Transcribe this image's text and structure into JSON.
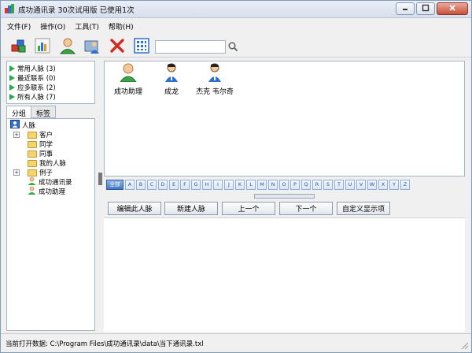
{
  "window": {
    "title": "成功通讯录 30次试用版 已使用1次",
    "minimize_icon": "minimize-icon",
    "maximize_icon": "maximize-icon",
    "close_icon": "close-icon"
  },
  "menu": {
    "items": [
      "文件(F)",
      "操作(O)",
      "工具(T)",
      "帮助(H)"
    ]
  },
  "toolbar": {
    "buttons": [
      "add-contacts-icon",
      "chart-icon",
      "person-icon",
      "import-icon",
      "delete-icon",
      "grid-view-icon"
    ],
    "search_value": "",
    "search_icon": "search-icon"
  },
  "recent": {
    "items": [
      "常用人脉 (3)",
      "最近联系 (0)",
      "应多联系 (2)",
      "所有人脉 (7)"
    ],
    "accent": "#2da64a"
  },
  "tabs": {
    "items": [
      "分组",
      "标签"
    ],
    "active": "分组"
  },
  "tree": {
    "root": "人脉",
    "children": [
      {
        "label": "客户",
        "expandable": true
      },
      {
        "label": "同学",
        "expandable": false
      },
      {
        "label": "同事",
        "expandable": false
      },
      {
        "label": "我的人脉",
        "expandable": false
      },
      {
        "label": "例子",
        "expandable": true
      },
      {
        "label": "成功通讯录",
        "expandable": false,
        "type": "person"
      },
      {
        "label": "成功助理",
        "expandable": false,
        "type": "person"
      }
    ]
  },
  "contacts": [
    {
      "name": "成功助理",
      "icon": "assistant-avatar-icon"
    },
    {
      "name": "成龙",
      "icon": "person-avatar-icon"
    },
    {
      "name": "杰克 韦尔奇",
      "icon": "person-avatar-icon"
    }
  ],
  "alphabet": {
    "all_label": "全部",
    "letters": [
      "A",
      "B",
      "C",
      "D",
      "E",
      "F",
      "G",
      "H",
      "I",
      "J",
      "K",
      "L",
      "M",
      "N",
      "O",
      "P",
      "Q",
      "R",
      "S",
      "T",
      "U",
      "V",
      "W",
      "X",
      "Y",
      "Z"
    ]
  },
  "actions": {
    "edit": "编辑此人脉",
    "new": "新建人脉",
    "prev": "上一个",
    "next": "下一个",
    "custom": "自定义显示项"
  },
  "status": {
    "text": "当前打开数据: C:\\Program Files\\成功通讯录\\data\\当下通讯录.txl"
  }
}
